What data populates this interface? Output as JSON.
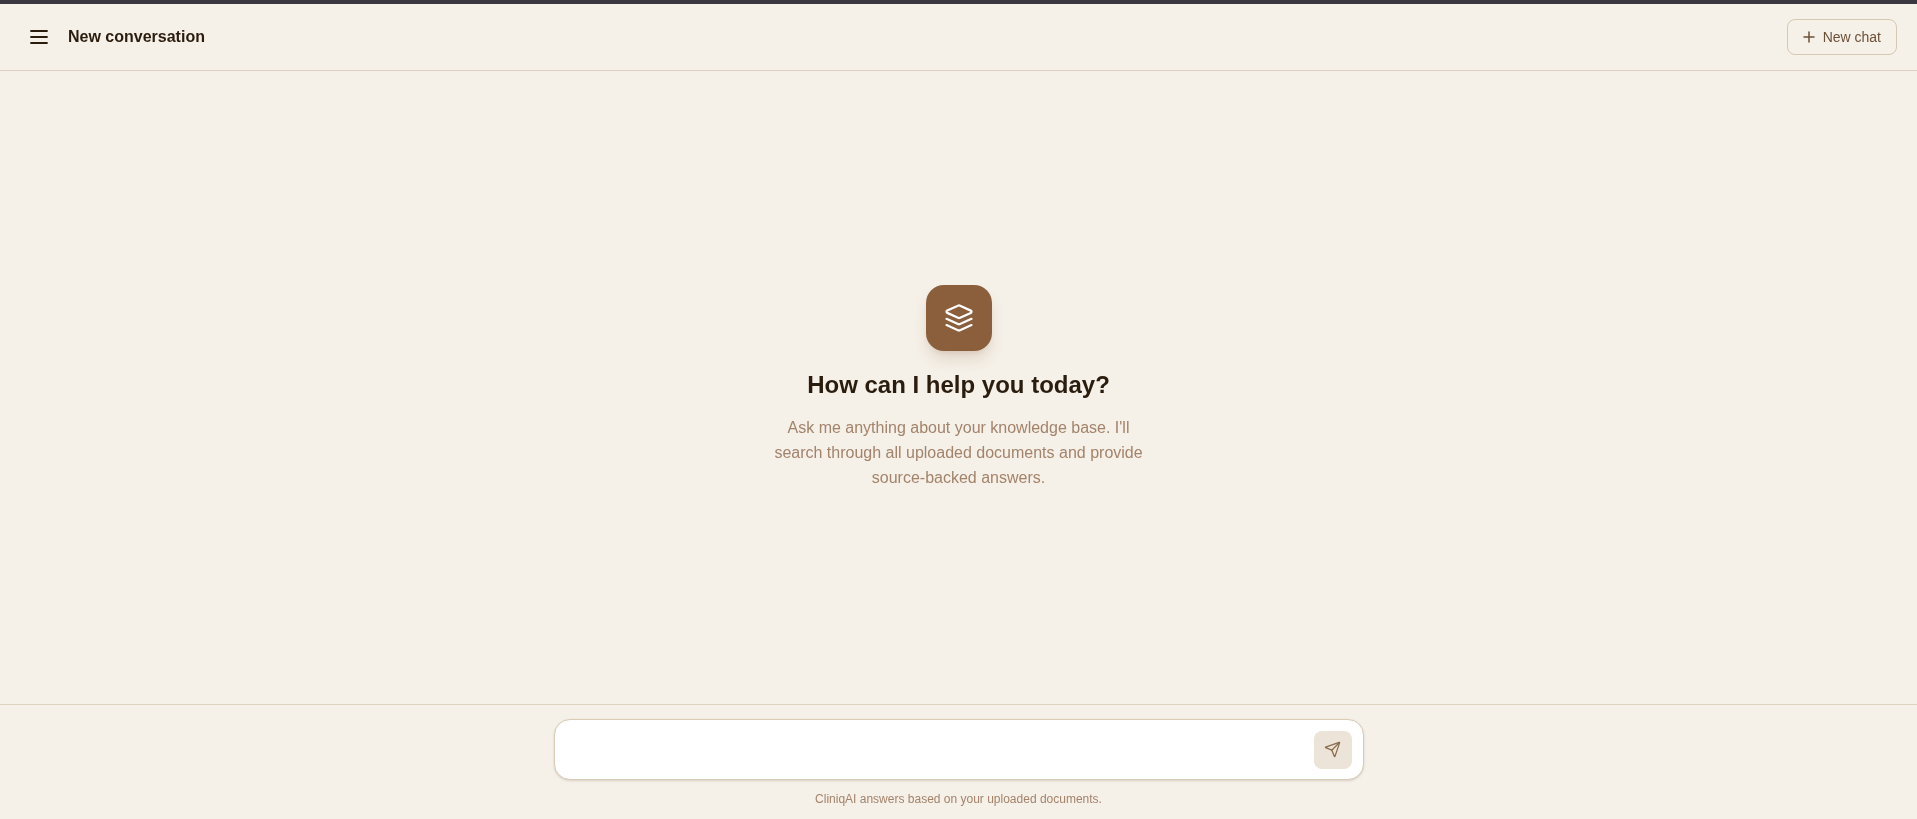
{
  "header": {
    "title": "New conversation",
    "new_chat_button": "New chat"
  },
  "welcome": {
    "heading": "How can I help you today?",
    "text": "Ask me anything about your knowledge base. I'll search through all uploaded documents and provide source-backed answers."
  },
  "composer": {
    "note": "CliniqAI answers based on your uploaded documents."
  }
}
